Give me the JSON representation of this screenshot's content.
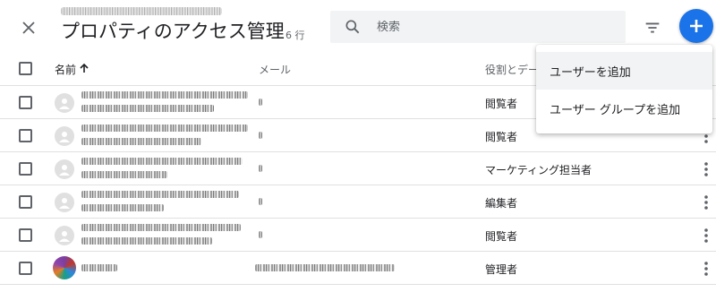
{
  "header": {
    "title": "プロパティのアクセス管理",
    "row_count": "6 行"
  },
  "search": {
    "placeholder": "検索"
  },
  "table": {
    "columns": [
      "名前",
      "メール",
      "役割とデー"
    ],
    "rows": [
      {
        "role": "閲覧者"
      },
      {
        "role": "閲覧者"
      },
      {
        "role": "マーケティング担当者"
      },
      {
        "role": "編集者"
      },
      {
        "role": "閲覧者"
      },
      {
        "role": "管理者"
      }
    ]
  },
  "menu": {
    "items": [
      "ユーザーを追加",
      "ユーザー グループを追加"
    ]
  },
  "colors": {
    "accent": "#1a73e8",
    "text": "#202124",
    "secondary_text": "#5f6368",
    "divider": "#e0e0e0",
    "search_bg": "#f1f3f4"
  },
  "icons": [
    "close-icon",
    "search-icon",
    "filter-icon",
    "plus-icon",
    "arrow-up-icon",
    "more-vert-icon",
    "person-icon"
  ]
}
